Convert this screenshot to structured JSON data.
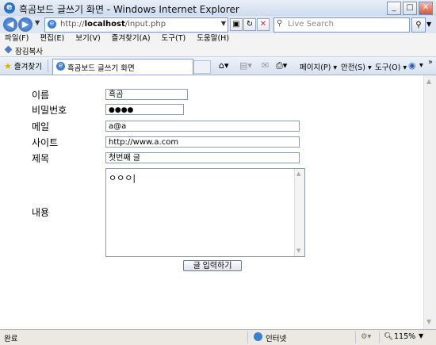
{
  "window": {
    "title": "흑곰보드 글쓰기 화면 - Windows Internet Explorer",
    "minimize": "_",
    "maximize": "□",
    "close": "✕"
  },
  "address": {
    "url_prefix": "http://",
    "url_host": "localhost",
    "url_path": "/input.php",
    "search_placeholder": "Live Search"
  },
  "menu": [
    "파일(F)",
    "편집(E)",
    "보기(V)",
    "즐겨찾기(A)",
    "도구(T)",
    "도움말(H)"
  ],
  "links": {
    "label": "잠김복사"
  },
  "tabrow": {
    "favorites": "즐겨찾기",
    "tab_title": "흑곰보드 글쓰기 화면",
    "page_menu": "페이지(P) ▾",
    "safety_menu": "안전(S) ▾",
    "tools_menu": "도구(O) ▾",
    "help_menu": "▾",
    "more": "»"
  },
  "form": {
    "name_label": "이름",
    "name_value": "흑곰",
    "password_label": "비밀번호",
    "password_value": "●●●●",
    "email_label": "메일",
    "email_value": "a@a",
    "site_label": "사이트",
    "site_value": "http://www.a.com",
    "subject_label": "제목",
    "subject_value": "첫번째 글",
    "content_label": "내용",
    "content_value": "ㅇㅇㅇ|",
    "submit_label": "글 입력하기"
  },
  "status": {
    "left": "완료",
    "zone": "인터넷",
    "zoom": "115%"
  }
}
